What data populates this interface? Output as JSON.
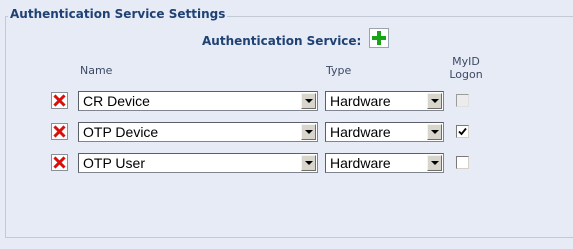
{
  "section": {
    "legend": "Authentication Service Settings",
    "service_label": "Authentication Service:"
  },
  "columns": {
    "name": "Name",
    "type": "Type",
    "logon": "MyID\nLogon"
  },
  "rows": [
    {
      "name": "CR Device",
      "type": "Hardware",
      "logon_checked": false,
      "logon_disabled": true
    },
    {
      "name": "OTP Device",
      "type": "Hardware",
      "logon_checked": true,
      "logon_disabled": false
    },
    {
      "name": "OTP User",
      "type": "Hardware",
      "logon_checked": false,
      "logon_disabled": false
    }
  ],
  "icons": {
    "add": "plus-icon",
    "delete": "red-x-icon",
    "dropdown": "chevron-down-icon"
  },
  "colors": {
    "panel_bg": "#e6ebf6",
    "heading": "#1f4273",
    "add_green": "#18a318",
    "delete_red": "#d8100c"
  }
}
